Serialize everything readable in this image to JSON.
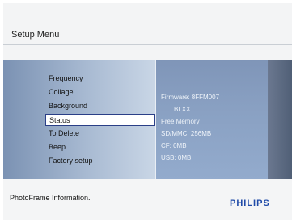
{
  "header": {
    "title": "Setup Menu"
  },
  "menu": {
    "items": [
      {
        "label": "Frequency"
      },
      {
        "label": "Collage"
      },
      {
        "label": "Background"
      },
      {
        "label": "Status",
        "selected": true
      },
      {
        "label": "To Delete"
      },
      {
        "label": "Beep"
      },
      {
        "label": "Factory setup"
      }
    ]
  },
  "status_info": {
    "firmware": "Firmware: 8FFM007",
    "firmware_extra": "BLXX",
    "free_memory": "Free Memory",
    "sd_mmc": "SD/MMC: 256MB",
    "cf": "CF: 0MB",
    "usb": "USB: 0MB"
  },
  "footer": {
    "description": "PhotoFrame Information.",
    "brand": "PHILIPS"
  },
  "colors": {
    "accent": "#1f4aa8",
    "selection_border": "#2a3f87"
  }
}
